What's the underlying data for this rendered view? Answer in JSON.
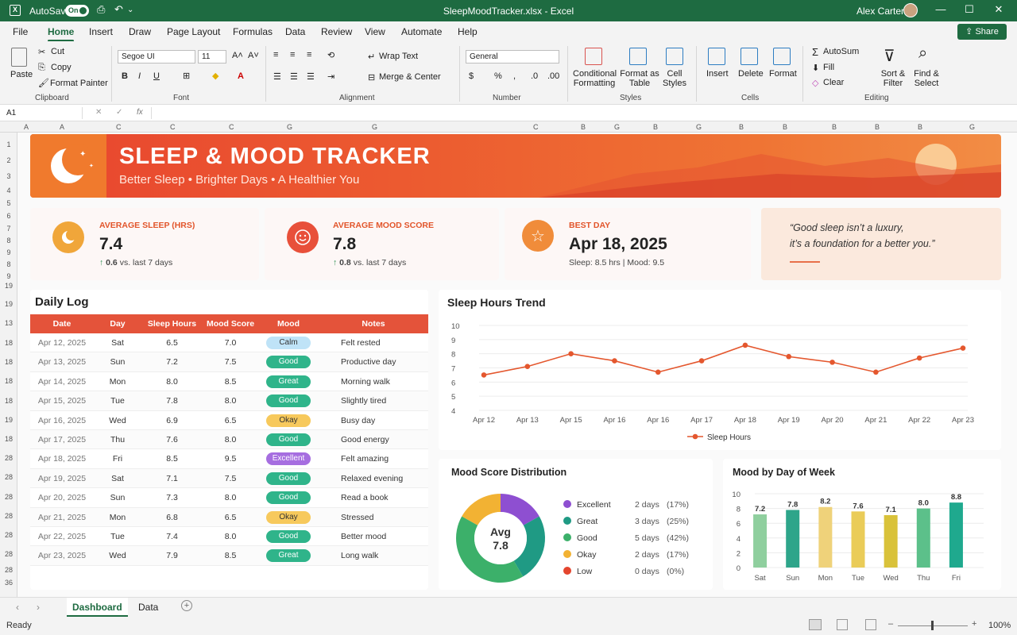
{
  "window": {
    "autosave_label": "AutoSave",
    "autosave_state": "On",
    "title": "SleepMoodTracker.xlsx - Excel",
    "user": "Alex Carter"
  },
  "menu": {
    "tabs": [
      "File",
      "Home",
      "Insert",
      "Draw",
      "Page Layout",
      "Formulas",
      "Data",
      "Review",
      "View",
      "Automate",
      "Help"
    ],
    "share": "Share"
  },
  "ribbon": {
    "clipboard": {
      "paste": "Paste",
      "cut": "Cut",
      "copy": "Copy",
      "format_painter": "Format Painter",
      "group": "Clipboard"
    },
    "font": {
      "name": "Segoe UI",
      "size": "11",
      "group": "Font"
    },
    "alignment": {
      "wrap": "Wrap Text",
      "merge": "Merge & Center",
      "group": "Alignment"
    },
    "number": {
      "format": "General",
      "group": "Number"
    },
    "styles": {
      "conditional": "Conditional Formatting",
      "format_table": "Format as Table",
      "cell_styles": "Cell Styles",
      "group": "Styles"
    },
    "cells": {
      "insert": "Insert",
      "delete": "Delete",
      "format": "Format",
      "group": "Cells"
    },
    "editing": {
      "autosum": "AutoSum",
      "fill": "Fill",
      "clear": "Clear",
      "sort": "Sort & Filter",
      "find": "Find & Select",
      "group": "Editing"
    }
  },
  "formula_bar": {
    "name_box": "A1",
    "fx": "fx"
  },
  "banner": {
    "title": "SLEEP & MOOD TRACKER",
    "subtitle": "Better Sleep  •  Brighter Days  •  A Healthier You"
  },
  "kpis": [
    {
      "label": "AVERAGE SLEEP (HRS)",
      "value": "7.4",
      "delta": "0.6",
      "delta_text": "vs. last 7 days",
      "color": "#f0a63a"
    },
    {
      "label": "AVERAGE MOOD SCORE",
      "value": "7.8",
      "delta": "0.8",
      "delta_text": "vs. last 7 days",
      "color": "#e8503a"
    },
    {
      "label": "BEST DAY",
      "value": "Apr 18, 2025",
      "detail": "Sleep: 8.5 hrs  |  Mood: 9.5",
      "color": "#f08c3a"
    }
  ],
  "quote": {
    "line1": "“Good sleep isn’t a luxury,",
    "line2": "it’s a foundation for a better you.”"
  },
  "daily_log": {
    "title": "Daily Log",
    "columns": [
      "Date",
      "Day",
      "Sleep Hours",
      "Mood Score",
      "Mood",
      "Notes"
    ],
    "rows": [
      {
        "date": "Apr 12, 2025",
        "day": "Sat",
        "sleep": "6.5",
        "mood_score": "7.0",
        "mood": "Calm",
        "notes": "Felt rested"
      },
      {
        "date": "Apr 13, 2025",
        "day": "Sun",
        "sleep": "7.2",
        "mood_score": "7.5",
        "mood": "Good",
        "notes": "Productive day"
      },
      {
        "date": "Apr 14, 2025",
        "day": "Mon",
        "sleep": "8.0",
        "mood_score": "8.5",
        "mood": "Great",
        "notes": "Morning walk"
      },
      {
        "date": "Apr 15, 2025",
        "day": "Tue",
        "sleep": "7.8",
        "mood_score": "8.0",
        "mood": "Good",
        "notes": "Slightly tired"
      },
      {
        "date": "Apr 16, 2025",
        "day": "Wed",
        "sleep": "6.9",
        "mood_score": "6.5",
        "mood": "Okay",
        "notes": "Busy day"
      },
      {
        "date": "Apr 17, 2025",
        "day": "Thu",
        "sleep": "7.6",
        "mood_score": "8.0",
        "mood": "Good",
        "notes": "Good energy"
      },
      {
        "date": "Apr 18, 2025",
        "day": "Fri",
        "sleep": "8.5",
        "mood_score": "9.5",
        "mood": "Excellent",
        "notes": "Felt amazing"
      },
      {
        "date": "Apr 19, 2025",
        "day": "Sat",
        "sleep": "7.1",
        "mood_score": "7.5",
        "mood": "Good",
        "notes": "Relaxed evening"
      },
      {
        "date": "Apr 20, 2025",
        "day": "Sun",
        "sleep": "7.3",
        "mood_score": "8.0",
        "mood": "Good",
        "notes": "Read a book"
      },
      {
        "date": "Apr 21, 2025",
        "day": "Mon",
        "sleep": "6.8",
        "mood_score": "6.5",
        "mood": "Okay",
        "notes": "Stressed"
      },
      {
        "date": "Apr 22, 2025",
        "day": "Tue",
        "sleep": "7.4",
        "mood_score": "8.0",
        "mood": "Good",
        "notes": "Better mood"
      },
      {
        "date": "Apr 23, 2025",
        "day": "Wed",
        "sleep": "7.9",
        "mood_score": "8.5",
        "mood": "Great",
        "notes": "Long walk"
      }
    ]
  },
  "mood_colors": {
    "Calm": "#bfe3f7",
    "Good": "#2fb48a",
    "Great": "#2fb48a",
    "Okay": "#f7c95c",
    "Excellent": "#a66ee0"
  },
  "chart_data": [
    {
      "type": "line",
      "title": "Sleep Hours Trend",
      "x": [
        "Apr 12",
        "Apr 13",
        "Apr 15",
        "Apr 16",
        "Apr 16",
        "Apr 17",
        "Apr 18",
        "Apr 19",
        "Apr 20",
        "Apr 21",
        "Apr 22",
        "Apr 23"
      ],
      "series": [
        {
          "name": "Sleep Hours",
          "values": [
            6.5,
            7.1,
            8.0,
            7.5,
            6.7,
            7.5,
            8.6,
            7.8,
            7.4,
            6.7,
            7.7,
            8.4
          ],
          "color": "#e4572e"
        }
      ],
      "ylim": [
        4,
        10
      ],
      "yticks": [
        4,
        5,
        6,
        7,
        8,
        9,
        10
      ],
      "grid": true,
      "legend": "bottom"
    },
    {
      "type": "pie",
      "title": "Mood Score Distribution",
      "center_label": "Avg",
      "center_value": "7.8",
      "slices": [
        {
          "label": "Excellent",
          "days": "2 days",
          "pct": "(17%)",
          "value": 17,
          "color": "#8e4fd1"
        },
        {
          "label": "Great",
          "days": "3 days",
          "pct": "(25%)",
          "value": 25,
          "color": "#1f9a84"
        },
        {
          "label": "Good",
          "days": "5 days",
          "pct": "(42%)",
          "value": 42,
          "color": "#3cb06a"
        },
        {
          "label": "Okay",
          "days": "2 days",
          "pct": "(17%)",
          "value": 17,
          "color": "#f2b233"
        },
        {
          "label": "Low",
          "days": "0 days",
          "pct": "(0%)",
          "value": 0,
          "color": "#e4452e"
        }
      ]
    },
    {
      "type": "bar",
      "title": "Mood by Day of Week",
      "categories": [
        "Sat",
        "Sun",
        "Mon",
        "Tue",
        "Wed",
        "Thu",
        "Fri"
      ],
      "values": [
        7.2,
        7.8,
        8.2,
        7.6,
        7.1,
        8.0,
        8.8
      ],
      "colors": [
        "#8fcf9e",
        "#2ea58a",
        "#efd27a",
        "#eacc58",
        "#d9c23a",
        "#5cc08a",
        "#1fa98e"
      ],
      "ylim": [
        0,
        10
      ],
      "yticks": [
        0,
        2,
        4,
        6,
        8,
        10
      ]
    }
  ],
  "sheet_tabs": [
    "Dashboard",
    "Data"
  ],
  "status": {
    "ready": "Ready",
    "zoom": "100%"
  }
}
